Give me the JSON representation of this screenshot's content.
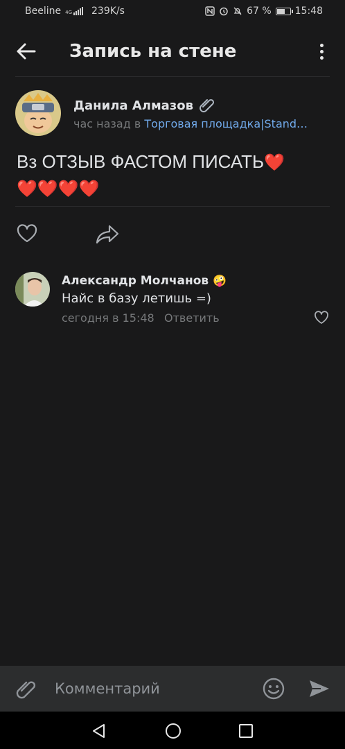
{
  "status_bar": {
    "carrier": "Beeline",
    "network_type": "4G",
    "speed": "239K/s",
    "battery_percent": "67 %",
    "battery_level": 0.67,
    "time": "15:48",
    "icons": [
      "nfc-icon",
      "alarm-icon",
      "mute-icon",
      "battery-icon"
    ]
  },
  "header": {
    "title": "Запись на стене",
    "back_icon": "arrow-left-icon",
    "more_icon": "more-vertical-icon"
  },
  "post": {
    "author": "Данила Алмазов",
    "author_badge_icon": "paperclip-icon",
    "time": "час назад в ",
    "group": "Торговая площадка|Stand…",
    "text_line1": "Вз ОТЗЫВ ФАСТОМ ПИСАТЬ",
    "text_line1_emoji": "❤️",
    "text_line2": "❤️❤️❤️❤️",
    "like_icon": "heart-outline-icon",
    "share_icon": "share-icon"
  },
  "comments": [
    {
      "author": "Александр Молчанов",
      "author_emoji": "🤪",
      "text": "Найс в базу летишь =)",
      "time": "сегодня в 15:48",
      "reply_label": "Ответить",
      "like_icon": "heart-outline-icon"
    }
  ],
  "input_bar": {
    "placeholder": "Комментарий",
    "value": "",
    "attach_icon": "paperclip-icon",
    "emoji_icon": "smile-icon",
    "send_icon": "send-icon"
  },
  "nav_bar": {
    "icons": [
      "nav-back-icon",
      "nav-home-icon",
      "nav-recents-icon"
    ]
  },
  "colors": {
    "background": "#19191a",
    "text_primary": "#e1e3e6",
    "text_secondary": "#76787a",
    "link": "#71aaeb",
    "input_bar": "#2c2d2e",
    "nav_bar": "#000000"
  }
}
